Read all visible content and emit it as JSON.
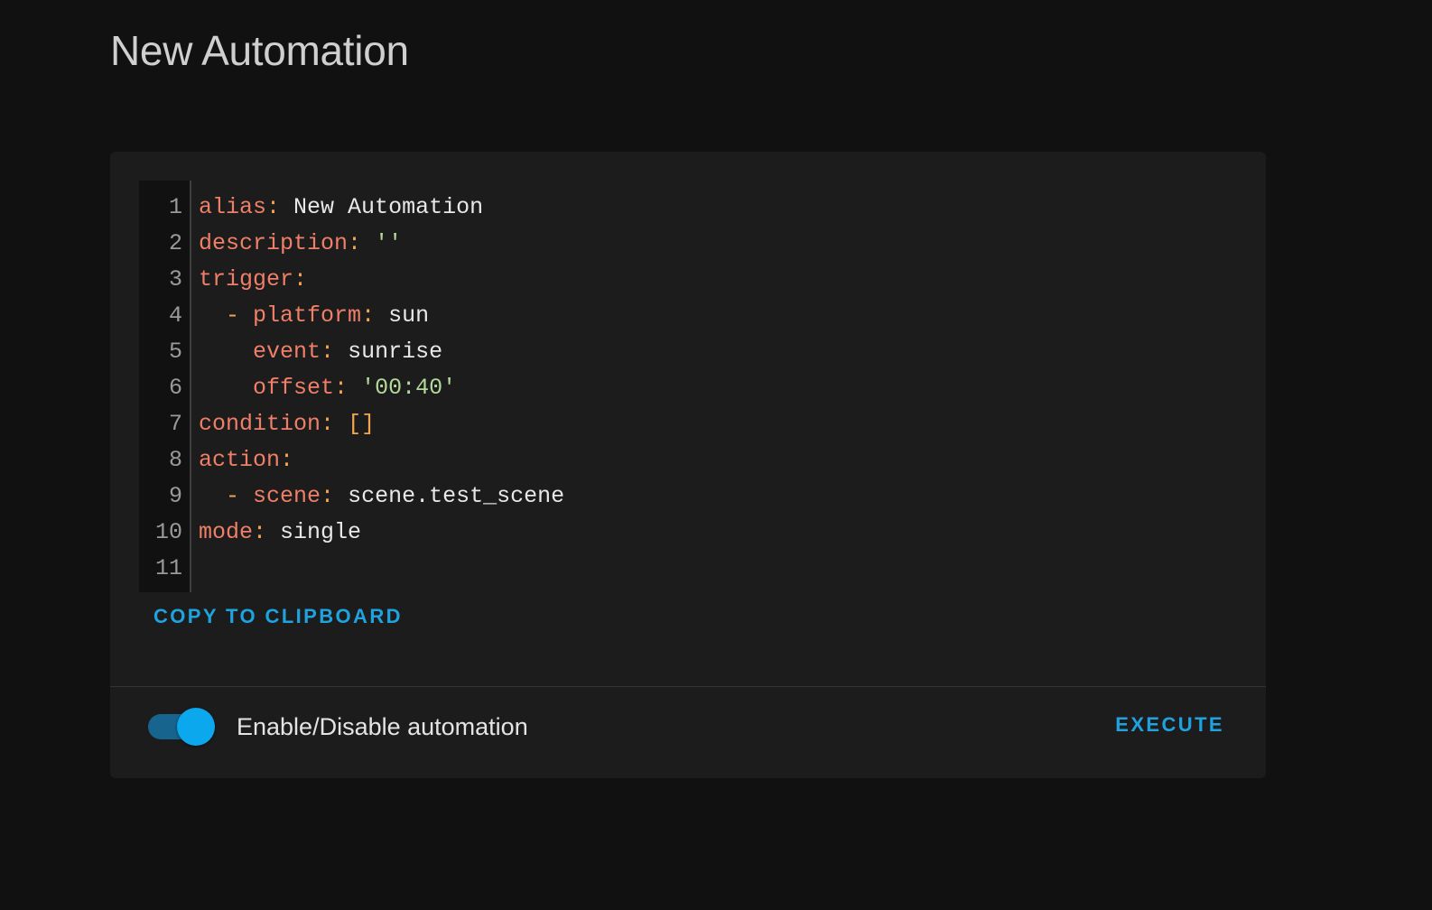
{
  "page": {
    "title": "New Automation"
  },
  "editor": {
    "line_numbers": [
      "1",
      "2",
      "3",
      "4",
      "5",
      "6",
      "7",
      "8",
      "9",
      "10",
      "11"
    ],
    "lines": [
      {
        "indent": "",
        "dash": "",
        "key": "alias",
        "colon": ":",
        "space": " ",
        "value": "New Automation",
        "value_type": "plain"
      },
      {
        "indent": "",
        "dash": "",
        "key": "description",
        "colon": ":",
        "space": " ",
        "value": "''",
        "value_type": "string"
      },
      {
        "indent": "",
        "dash": "",
        "key": "trigger",
        "colon": ":",
        "space": "",
        "value": "",
        "value_type": "plain"
      },
      {
        "indent": "  ",
        "dash": "- ",
        "key": "platform",
        "colon": ":",
        "space": " ",
        "value": "sun",
        "value_type": "plain"
      },
      {
        "indent": "    ",
        "dash": "",
        "key": "event",
        "colon": ":",
        "space": " ",
        "value": "sunrise",
        "value_type": "plain"
      },
      {
        "indent": "    ",
        "dash": "",
        "key": "offset",
        "colon": ":",
        "space": " ",
        "value": "'00:40'",
        "value_type": "string"
      },
      {
        "indent": "",
        "dash": "",
        "key": "condition",
        "colon": ":",
        "space": " ",
        "value": "[]",
        "value_type": "punct"
      },
      {
        "indent": "",
        "dash": "",
        "key": "action",
        "colon": ":",
        "space": "",
        "value": "",
        "value_type": "plain"
      },
      {
        "indent": "  ",
        "dash": "- ",
        "key": "scene",
        "colon": ":",
        "space": " ",
        "value": "scene.test_scene",
        "value_type": "plain"
      },
      {
        "indent": "",
        "dash": "",
        "key": "mode",
        "colon": ":",
        "space": " ",
        "value": "single",
        "value_type": "plain"
      },
      {
        "indent": "",
        "dash": "",
        "key": "",
        "colon": "",
        "space": "",
        "value": "",
        "value_type": "plain"
      }
    ]
  },
  "actions": {
    "copy_label": "COPY TO CLIPBOARD",
    "execute_label": "EXECUTE"
  },
  "toggle": {
    "label": "Enable/Disable automation",
    "checked": true
  },
  "colors": {
    "background": "#111111",
    "card": "#1c1c1c",
    "accent": "#1fa3e0",
    "yaml_key": "#f07f68",
    "yaml_punct": "#f3a64f",
    "yaml_string": "#b4d89a"
  }
}
